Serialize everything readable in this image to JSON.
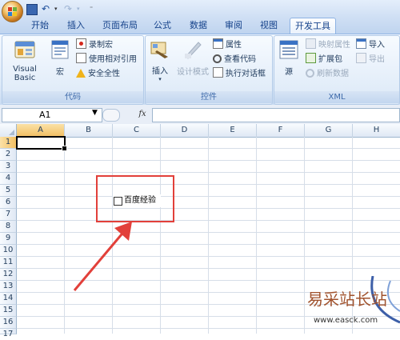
{
  "qat": {
    "icons": [
      "save-icon",
      "undo-icon",
      "redo-icon",
      "qat-dropdown-icon"
    ]
  },
  "tabs": [
    "开始",
    "插入",
    "页面布局",
    "公式",
    "数据",
    "审阅",
    "视图",
    "开发工具"
  ],
  "active_tab": "开发工具",
  "ribbon": {
    "code_group": {
      "label": "代码",
      "visual_basic": "Visual Basic",
      "macros": "宏",
      "record_macro": "录制宏",
      "relative_refs": "使用相对引用",
      "macro_security": "安全全性"
    },
    "controls_group": {
      "label": "控件",
      "insert": "插入",
      "design_mode": "设计模式",
      "properties": "属性",
      "view_code": "查看代码",
      "run_dialog": "执行对话框"
    },
    "xml_group": {
      "label": "XML",
      "source": "源",
      "map_properties": "映射属性",
      "expansion_packs": "扩展包",
      "refresh_data": "刷新数据",
      "import": "导入",
      "export": "导出"
    }
  },
  "formula_bar": {
    "name_box": "A1",
    "fx": "fx",
    "value": ""
  },
  "columns": [
    "A",
    "B",
    "C",
    "D",
    "E",
    "F",
    "G",
    "H"
  ],
  "rows": [
    "1",
    "2",
    "3",
    "4",
    "5",
    "6",
    "7",
    "8",
    "9",
    "10",
    "11",
    "12",
    "13",
    "14",
    "15",
    "16",
    "17"
  ],
  "checkbox": {
    "label": "百度经验",
    "checked": false
  },
  "colors": {
    "highlight": "#e2403a",
    "arrow": "#e2403a",
    "active_tab_border": "#8db2e3"
  },
  "watermark": {
    "text": "易采站长站",
    "url": "www.easck.com"
  }
}
